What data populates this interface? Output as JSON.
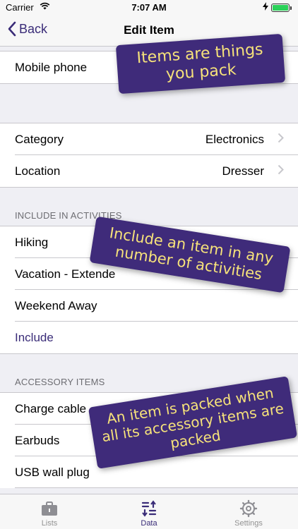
{
  "status": {
    "carrier": "Carrier",
    "time": "7:07 AM"
  },
  "nav": {
    "back_label": "Back",
    "title": "Edit Item"
  },
  "item": {
    "name": "Mobile phone"
  },
  "details": [
    {
      "label": "Category",
      "value": "Electronics"
    },
    {
      "label": "Location",
      "value": "Dresser"
    }
  ],
  "activities": {
    "header": "INCLUDE IN ACTIVITIES",
    "items": [
      "Hiking",
      "Vacation - Extende",
      "Weekend Away"
    ],
    "include_label": "Include"
  },
  "accessories": {
    "header": "ACCESSORY ITEMS",
    "items": [
      "Charge cable",
      "Earbuds",
      "USB wall plug"
    ]
  },
  "callouts": [
    "Items are things you pack",
    "Include an item in any number of activities",
    "An item is packed when all its accessory items are packed"
  ],
  "tabs": [
    {
      "label": "Lists",
      "icon": "suitcase-icon"
    },
    {
      "label": "Data",
      "icon": "data-list-icon"
    },
    {
      "label": "Settings",
      "icon": "gear-icon"
    }
  ],
  "colors": {
    "accent": "#3a2c78",
    "callout_bg": "#3f2b7a",
    "callout_text": "#f6e27a"
  }
}
